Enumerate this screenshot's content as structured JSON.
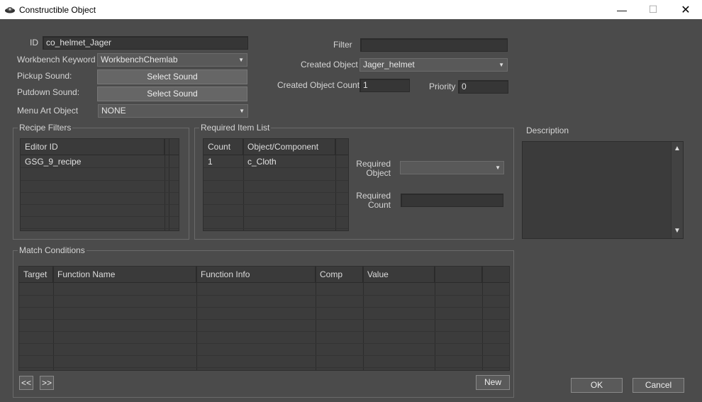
{
  "window": {
    "title": "Constructible Object",
    "minimize": "—",
    "maximize": "☐",
    "close": "✕"
  },
  "form": {
    "id_label": "ID",
    "id_value": "co_helmet_Jager",
    "workbench_label": "Workbench Keyword",
    "workbench_value": "WorkbenchChemlab",
    "pickup_label": "Pickup Sound:",
    "pickup_button": "Select Sound",
    "putdown_label": "Putdown Sound:",
    "putdown_button": "Select Sound",
    "menuart_label": "Menu Art Object",
    "menuart_value": "NONE",
    "filter_label": "Filter",
    "filter_value": "",
    "created_object_label": "Created Object",
    "created_object_value": "Jager_helmet",
    "created_count_label": "Created Object Count",
    "created_count_value": "1",
    "priority_label": "Priority",
    "priority_value": "0"
  },
  "recipe_filters": {
    "title": "Recipe Filters",
    "columns": [
      "Editor ID"
    ],
    "rows": [
      [
        "GSG_9_recipe"
      ]
    ]
  },
  "required_items": {
    "title": "Required Item List",
    "columns": [
      "Count",
      "Object/Component"
    ],
    "rows": [
      [
        "1",
        "c_Cloth"
      ]
    ],
    "required_object_label_1": "Required",
    "required_object_label_2": "Object",
    "required_object_value": "",
    "required_count_label_1": "Required",
    "required_count_label_2": "Count",
    "required_count_value": ""
  },
  "description": {
    "label": "Description",
    "value": ""
  },
  "match_conditions": {
    "title": "Match Conditions",
    "columns": [
      "Target",
      "Function Name",
      "Function Info",
      "Comp",
      "Value"
    ],
    "prev_button": "<<",
    "next_button": ">>",
    "new_button": "New"
  },
  "footer": {
    "ok": "OK",
    "cancel": "Cancel"
  }
}
